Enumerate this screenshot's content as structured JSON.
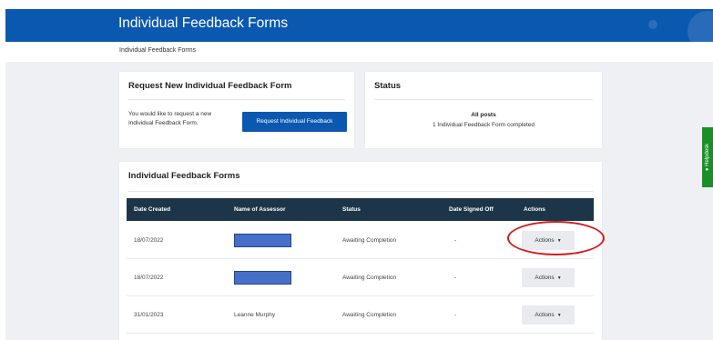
{
  "header": {
    "title": "Individual Feedback Forms"
  },
  "breadcrumb": "Individual Feedback Forms",
  "request_card": {
    "title": "Request New Individual Feedback Form",
    "description": "You would like to request a new Individual Feedback Form.",
    "button_label": "Request Individual Feedback"
  },
  "status_card": {
    "title": "Status",
    "all_posts": "All posts",
    "summary": "1 Individual Feedback Form completed"
  },
  "forms_card": {
    "title": "Individual Feedback Forms",
    "columns": {
      "date_created": "Date Created",
      "assessor": "Name of Assessor",
      "status": "Status",
      "signed_off": "Date Signed Off",
      "actions": "Actions"
    },
    "rows": [
      {
        "date": "18/07/2022",
        "assessor": "",
        "status": "Awaiting Completion",
        "signed_off": "-",
        "action_label": "Actions"
      },
      {
        "date": "18/07/2022",
        "assessor": "",
        "status": "Awaiting Completion",
        "signed_off": "-",
        "action_label": "Actions"
      },
      {
        "date": "31/01/2023",
        "assessor": "Leanne Murphy",
        "status": "Awaiting Completion",
        "signed_off": "-",
        "action_label": "Actions"
      }
    ]
  },
  "helpdesk": {
    "label": "Helpdesk",
    "icon": "question-circle-icon"
  },
  "colors": {
    "brand_blue": "#0b58b0",
    "table_header": "#1d3548",
    "helpdesk_green": "#1a8f28",
    "annotation_red": "#d21b1b"
  }
}
